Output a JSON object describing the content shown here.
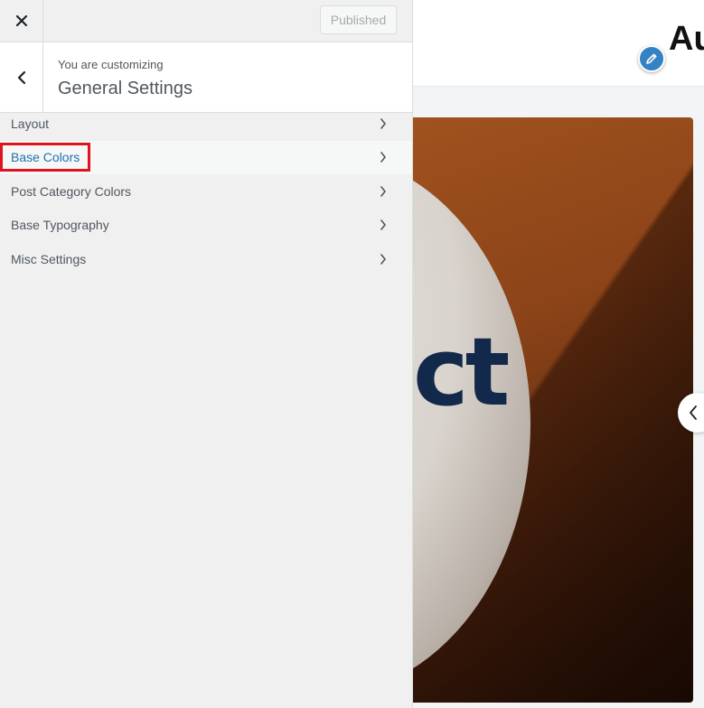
{
  "topbar": {
    "close_icon": "close-icon",
    "publish_label": "Published"
  },
  "section": {
    "back_icon": "chevron-left-icon",
    "customizing_label": "You are customizing",
    "title": "General Settings"
  },
  "menu": {
    "items": [
      {
        "label": "Layout",
        "icon": "chevron-right-icon"
      },
      {
        "label": "Base Colors",
        "icon": "chevron-right-icon",
        "highlighted": true
      },
      {
        "label": "Post Category Colors",
        "icon": "chevron-right-icon"
      },
      {
        "label": "Base Typography",
        "icon": "chevron-right-icon"
      },
      {
        "label": "Misc Settings",
        "icon": "chevron-right-icon"
      }
    ]
  },
  "preview": {
    "site_title": "Au",
    "edit_icon": "pencil-icon",
    "hero_text": "ct",
    "slider_prev_icon": "chevron-left-icon"
  },
  "colors": {
    "accent": "#2271b1",
    "highlight_border": "#e0141e",
    "edit_button": "#3582c4"
  }
}
